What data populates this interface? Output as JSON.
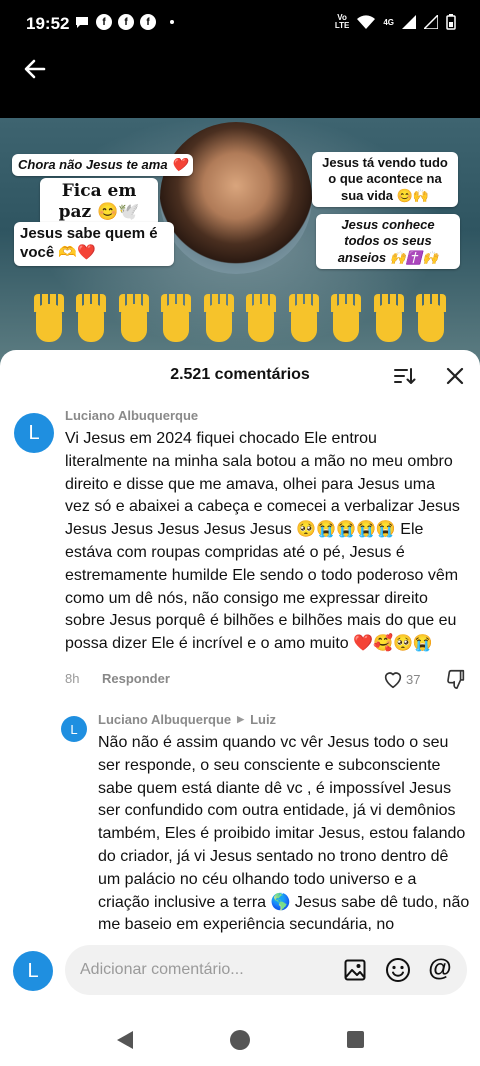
{
  "status_bar": {
    "time": "19:52",
    "notification_icons": [
      "chat-bubble-icon",
      "facebook-icon",
      "facebook-icon",
      "facebook-icon"
    ],
    "network_top": "Vo",
    "network_bottom": "LTE",
    "network_type": "4G"
  },
  "video": {
    "stickers": [
      "Chora não Jesus te ama ❤️",
      "Fica em paz 😊🕊️",
      "Jesus sabe quem é você 🫶❤️",
      "Jesus tá vendo tudo o que acontece na sua vida 😊🙌",
      "Jesus conhece todos os seus anseios 🙌✝️🙌"
    ]
  },
  "comments_panel": {
    "title": "2.521 comentários",
    "comments": [
      {
        "avatar_letter": "L",
        "author": "Luciano Albuquerque",
        "text": "Vi Jesus em 2024 fiquei chocado Ele entrou literalmente na minha sala botou a mão no meu ombro direito e disse que me amava, olhei para Jesus uma vez só e abaixei a cabeça e comecei a verbalizar Jesus Jesus Jesus Jesus Jesus Jesus 🥺😭😭😭😭 Ele estáva com roupas compridas até o pé, Jesus é estremamente humilde Ele sendo o todo poderoso vêm como um dê nós, não consigo me expressar direito sobre Jesus porquê é bilhões e bilhões mais do que eu possa dizer Ele é incrível e o amo muito ❤️🥰🥺😭",
        "time": "8h",
        "reply_label": "Responder",
        "likes": "37"
      }
    ],
    "reply": {
      "avatar_letter": "L",
      "author": "Luciano Albuquerque",
      "reply_to": "Luiz",
      "text": "Não não é assim quando vc vêr Jesus todo o seu ser responde, o seu consciente e subconsciente sabe quem está diante dê vc , é impossível Jesus ser confundido com outra entidade, já vi demônios também, Eles é proibido imitar Jesus, estou falando do criador, já vi Jesus sentado no trono dentro dê um palácio no céu olhando todo universo e a criação inclusive a terra 🌎 Jesus sabe dê tudo, não me baseio em experiência secundária, no"
    },
    "input": {
      "avatar_letter": "L",
      "placeholder": "Adicionar comentário..."
    }
  },
  "colors": {
    "avatar": "#1f8fe0",
    "muted_text": "#8a8a8a",
    "heart": "#e0245e"
  }
}
